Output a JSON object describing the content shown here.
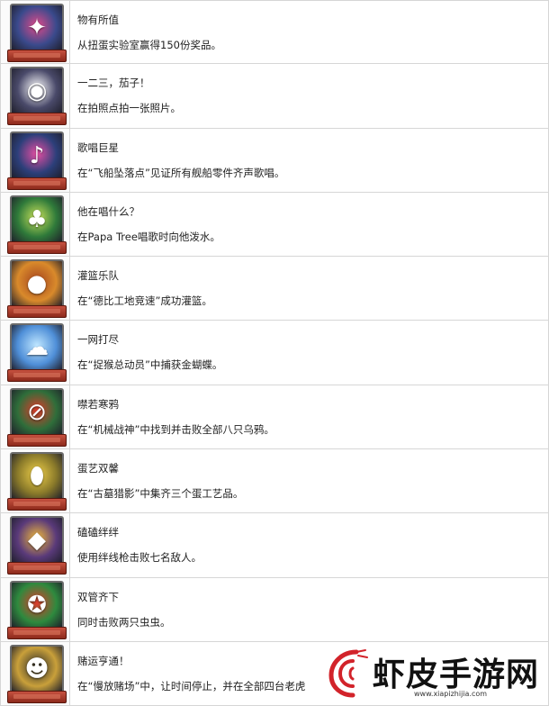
{
  "achievements": [
    {
      "title": "物有所值",
      "desc": "从扭蛋实验室赢得150份奖品。",
      "icon": "gacha-prizes-icon",
      "bg": "#3a4a8c",
      "accent": "#e04a8a",
      "glyph": "✦"
    },
    {
      "title": "一二三，茄子！",
      "desc": "在拍照点拍一张照片。",
      "icon": "camera-robot-icon",
      "bg": "#4a4a6a",
      "accent": "#ffffff",
      "glyph": "◉"
    },
    {
      "title": "歌唱巨星",
      "desc": "在“飞船坠落点”见证所有舰船零件齐声歌唱。",
      "icon": "singing-robot-icon",
      "bg": "#2c3f7a",
      "accent": "#e84ea3",
      "glyph": "♪"
    },
    {
      "title": "他在唱什么？",
      "desc": "在Papa Tree唱歌时向他泼水。",
      "icon": "papa-tree-icon",
      "bg": "#2f7a3a",
      "accent": "#c9e25a",
      "glyph": "♣"
    },
    {
      "title": "灌篮乐队",
      "desc": "在“德比工地竞速”成功灌篮。",
      "icon": "basketball-icon",
      "bg": "#d98a2b",
      "accent": "#a4441e",
      "glyph": "●"
    },
    {
      "title": "一网打尽",
      "desc": "在“捉猴总动员”中捕获金蝴蝶。",
      "icon": "butterfly-net-icon",
      "bg": "#4f8fd8",
      "accent": "#bfe6ff",
      "glyph": "☁"
    },
    {
      "title": "噤若寒鸦",
      "desc": "在“机械战神”中找到并击败全部八只乌鸦。",
      "icon": "crossed-crow-icon",
      "bg": "#2f6e3a",
      "accent": "#e03a2a",
      "glyph": "⊘"
    },
    {
      "title": "蛋艺双馨",
      "desc": "在“古墓猎影”中集齐三个蛋工艺品。",
      "icon": "golden-egg-icon",
      "bg": "#8a7a2a",
      "accent": "#f0d04a",
      "glyph": "⬮"
    },
    {
      "title": "磕磕绊绊",
      "desc": "使用绊线枪击败七名敌人。",
      "icon": "tripwire-icon",
      "bg": "#5a3a7a",
      "accent": "#f0b83a",
      "glyph": "◆"
    },
    {
      "title": "双管齐下",
      "desc": "同时击败两只虫虫。",
      "icon": "twin-bugs-icon",
      "bg": "#2e8a3e",
      "accent": "#e03a2a",
      "glyph": "✪"
    },
    {
      "title": "赌运亨通！",
      "desc": "在“慢放赌场”中，让时间停止，并在全部四台老虎",
      "icon": "slot-machine-icon",
      "bg": "#c9a03a",
      "accent": "#2a2a2a",
      "glyph": "☻"
    }
  ],
  "watermark": {
    "text": "虾皮手游网",
    "url": "www.xiapizhijia.com",
    "logo_icon": "shrimp-logo-icon",
    "logo_color": "#d2232a"
  }
}
